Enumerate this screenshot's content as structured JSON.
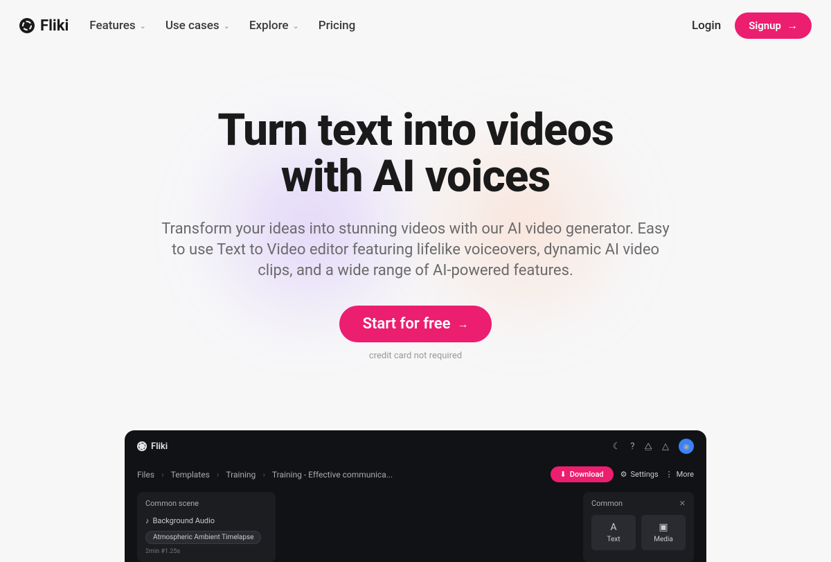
{
  "brand": "Fliki",
  "nav": {
    "items": [
      "Features",
      "Use cases",
      "Explore",
      "Pricing"
    ],
    "login": "Login",
    "signup": "Signup"
  },
  "hero": {
    "title_l1": "Turn text into videos",
    "title_l2": "with AI voices",
    "subtitle": "Transform your ideas into stunning videos with our AI video generator. Easy to use Text to Video editor featuring lifelike voiceovers, dynamic AI video clips, and a wide range of AI-powered features.",
    "cta": "Start for free",
    "note": "credit card not required"
  },
  "app": {
    "brand": "Fliki",
    "breadcrumbs": [
      "Files",
      "Templates",
      "Training",
      "Training - Effective communica..."
    ],
    "download": "Download",
    "settings": "Settings",
    "more": "More",
    "left": {
      "title": "Common scene",
      "audio": "Background Audio",
      "tag": "Atmospheric Ambient Timelapse",
      "time": "2min #1.25s"
    },
    "right": {
      "title": "Common",
      "tiles": [
        {
          "label": "Text"
        },
        {
          "label": "Media"
        }
      ]
    }
  }
}
